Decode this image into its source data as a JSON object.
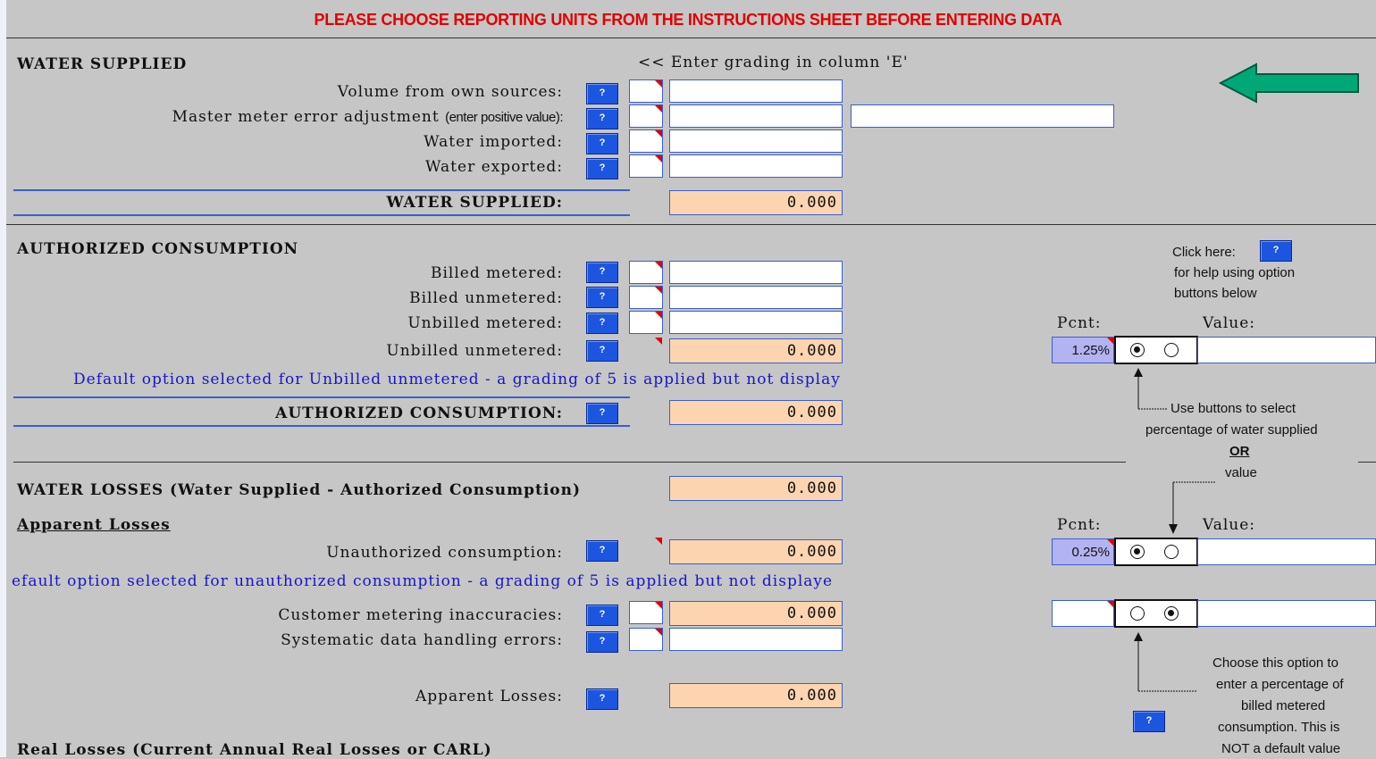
{
  "banner": "PLEASE CHOOSE REPORTING UNITS FROM THE INSTRUCTIONS SHEET BEFORE ENTERING DATA",
  "help_button_label": "?",
  "water_supplied": {
    "heading": "WATER SUPPLIED",
    "hint": "<< Enter grading in column 'E'",
    "rows": [
      {
        "label": "Volume from own sources:"
      },
      {
        "label": "Master meter error adjustment",
        "sublabel": "(enter positive value):"
      },
      {
        "label": "Water imported:"
      },
      {
        "label": "Water exported:"
      }
    ],
    "total_label": "WATER SUPPLIED:",
    "total_value": "0.000"
  },
  "authorized_consumption": {
    "heading": "AUTHORIZED CONSUMPTION",
    "rows": [
      {
        "label": "Billed metered:"
      },
      {
        "label": "Billed unmetered:"
      },
      {
        "label": "Unbilled metered:"
      },
      {
        "label": "Unbilled unmetered:",
        "value": "0.000"
      }
    ],
    "default_note": "Default option selected for Unbilled unmetered - a grading of 5 is applied but not display",
    "total_label": "AUTHORIZED CONSUMPTION:",
    "total_value": "0.000",
    "pcnt_label": "Pcnt:",
    "value_label": "Value:",
    "pcnt_value": "1.25%"
  },
  "side_help": {
    "click_here": "Click here:",
    "line2": "for help using option",
    "line3": "buttons below",
    "use_buttons_1": "Use buttons to select",
    "use_buttons_2": "percentage of water supplied",
    "or": "OR",
    "value": "value",
    "choose_1": "Choose this option to",
    "choose_2": "enter a percentage of",
    "choose_3": "billed metered",
    "choose_4": "consumption. This is",
    "choose_5": "NOT a default value"
  },
  "water_losses": {
    "label": "WATER LOSSES (Water Supplied - Authorized Consumption)",
    "value": "0.000"
  },
  "apparent_losses": {
    "heading": "Apparent Losses",
    "unauthorized_label": "Unauthorized consumption:",
    "unauthorized_value": "0.000",
    "pcnt_label": "Pcnt:",
    "value_label": "Value:",
    "pcnt_value": "0.25%",
    "default_note": "efault option selected for unauthorized consumption - a grading of 5 is applied but not displaye",
    "customer_label": "Customer metering inaccuracies:",
    "customer_value": "0.000",
    "systematic_label": "Systematic data handling errors:",
    "total_label": "Apparent Losses:",
    "total_value": "0.000"
  },
  "real_losses": {
    "heading": "Real Losses (Current Annual Real Losses or CARL)"
  },
  "colors": {
    "background": "#c6c6c6",
    "help_button": "#1c56e0",
    "calc_cell": "#fcd5b0",
    "pct_cell": "#b3b3f2",
    "banner_red": "#e00000",
    "note_blue": "#1616c8",
    "arrow_green": "#00a878"
  }
}
